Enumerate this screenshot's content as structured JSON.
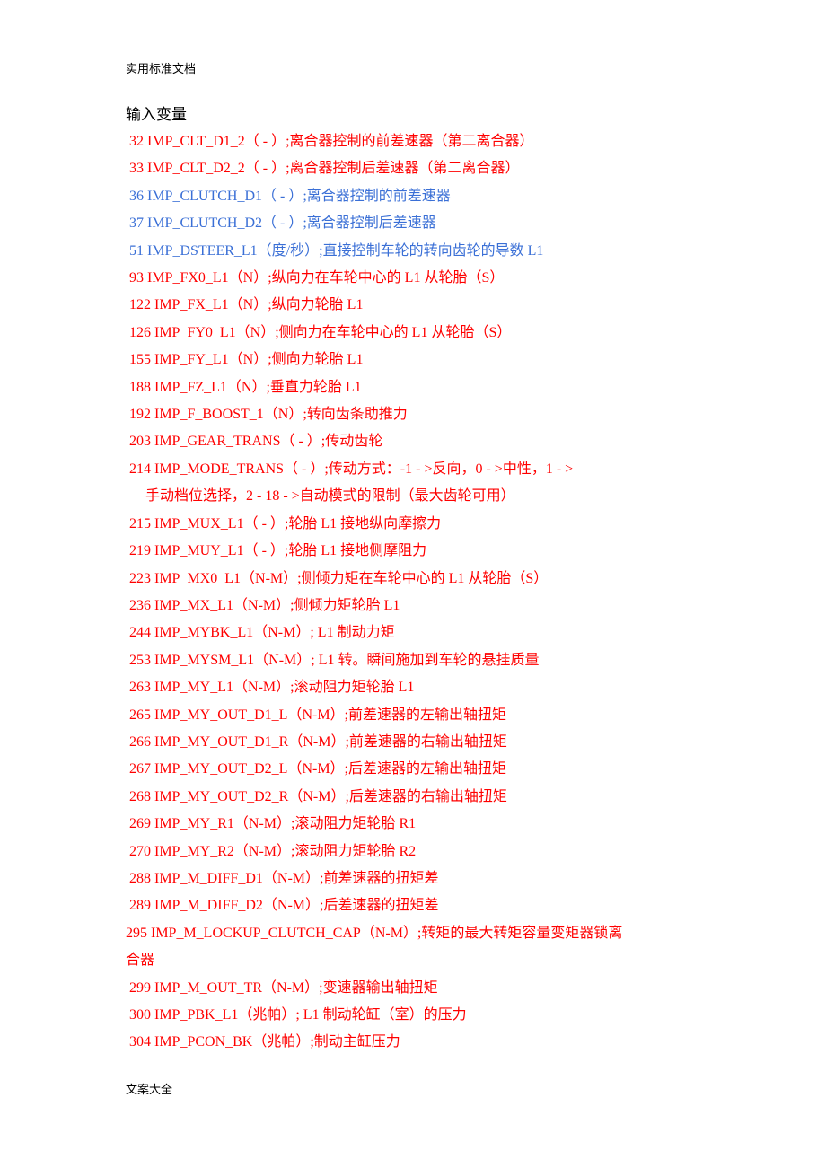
{
  "header": {
    "text": "实用标准文档"
  },
  "footer": {
    "text": "文案大全"
  },
  "section_title": "输入变量",
  "colors": {
    "red": "#ff0000",
    "blue": "#3a6fd6",
    "text": "#000000"
  },
  "items": [
    {
      "text": "32 IMP_CLT_D1_2（ - ）;离合器控制的前差速器（第二离合器）",
      "color": "red"
    },
    {
      "text": "33 IMP_CLT_D2_2（ - ）;离合器控制后差速器（第二离合器）",
      "color": "red"
    },
    {
      "text": "36 IMP_CLUTCH_D1（ - ）;离合器控制的前差速器",
      "color": "blue"
    },
    {
      "text": "37 IMP_CLUTCH_D2（ - ）;离合器控制后差速器",
      "color": "blue"
    },
    {
      "text": "51 IMP_DSTEER_L1（度/秒）;直接控制车轮的转向齿轮的导数  L1",
      "color": "blue"
    },
    {
      "text": "93 IMP_FX0_L1（N）;纵向力在车轮中心的  L1 从轮胎（S）",
      "color": "red"
    },
    {
      "text": "122 IMP_FX_L1（N）;纵向力轮胎  L1",
      "color": "red"
    },
    {
      "text": "126 IMP_FY0_L1（N）;侧向力在车轮中心的  L1 从轮胎（S）",
      "color": "red"
    },
    {
      "text": "155 IMP_FY_L1（N）;侧向力轮胎  L1",
      "color": "red"
    },
    {
      "text": "188 IMP_FZ_L1（N）;垂直力轮胎  L1",
      "color": "red"
    },
    {
      "text": "192 IMP_F_BOOST_1（N）;转向齿条助推力",
      "color": "red"
    },
    {
      "text": "203 IMP_GEAR_TRANS（ - ）;传动齿轮",
      "color": "red"
    },
    {
      "text": "214 IMP_MODE_TRANS（ - ）;传动方式：-1 - >反向，0 - >中性，1 - >",
      "continuation": "手动档位选择，2 - 18 - >自动模式的限制（最大齿轮可用）",
      "color": "red"
    },
    {
      "text": "215 IMP_MUX_L1（ - ）;轮胎  L1 接地纵向摩擦力",
      "color": "red"
    },
    {
      "text": "219 IMP_MUY_L1（ - ）;轮胎  L1 接地侧摩阻力",
      "color": "red"
    },
    {
      "text": "223 IMP_MX0_L1（N-M）;侧倾力矩在车轮中心的  L1 从轮胎（S）",
      "color": "red"
    },
    {
      "text": "236 IMP_MX_L1（N-M）;侧倾力矩轮胎  L1",
      "color": "red"
    },
    {
      "text": "244 IMP_MYBK_L1（N-M）; L1 制动力矩",
      "color": "red"
    },
    {
      "text": "253 IMP_MYSM_L1（N-M）; L1 转。瞬间施加到车轮的悬挂质量",
      "color": "red"
    },
    {
      "text": "263 IMP_MY_L1（N-M）;滚动阻力矩轮胎  L1",
      "color": "red"
    },
    {
      "text": "265 IMP_MY_OUT_D1_L（N-M）;前差速器的左输出轴扭矩",
      "color": "red"
    },
    {
      "text": "266 IMP_MY_OUT_D1_R（N-M）;前差速器的右输出轴扭矩",
      "color": "red"
    },
    {
      "text": "267 IMP_MY_OUT_D2_L（N-M）;后差速器的左输出轴扭矩",
      "color": "red"
    },
    {
      "text": "268 IMP_MY_OUT_D2_R（N-M）;后差速器的右输出轴扭矩",
      "color": "red"
    },
    {
      "text": "269 IMP_MY_R1（N-M）;滚动阻力矩轮胎  R1",
      "color": "red"
    },
    {
      "text": "270 IMP_MY_R2（N-M）;滚动阻力矩轮胎  R2",
      "color": "red"
    },
    {
      "text": "288 IMP_M_DIFF_D1（N-M）;前差速器的扭矩差",
      "color": "red"
    },
    {
      "text": "289 IMP_M_DIFF_D2（N-M）;后差速器的扭矩差",
      "color": "red"
    },
    {
      "text": "295 IMP_M_LOCKUP_CLUTCH_CAP（N-M）;转矩的最大转矩容量变矩器锁离",
      "continuation": "合器",
      "color": "red"
    },
    {
      "text": "299 IMP_M_OUT_TR（N-M）;变速器输出轴扭矩",
      "color": "red"
    },
    {
      "text": "300 IMP_PBK_L1（兆帕）; L1 制动轮缸（室）的压力",
      "color": "red"
    },
    {
      "text": "304 IMP_PCON_BK（兆帕）;制动主缸压力",
      "color": "red"
    }
  ]
}
